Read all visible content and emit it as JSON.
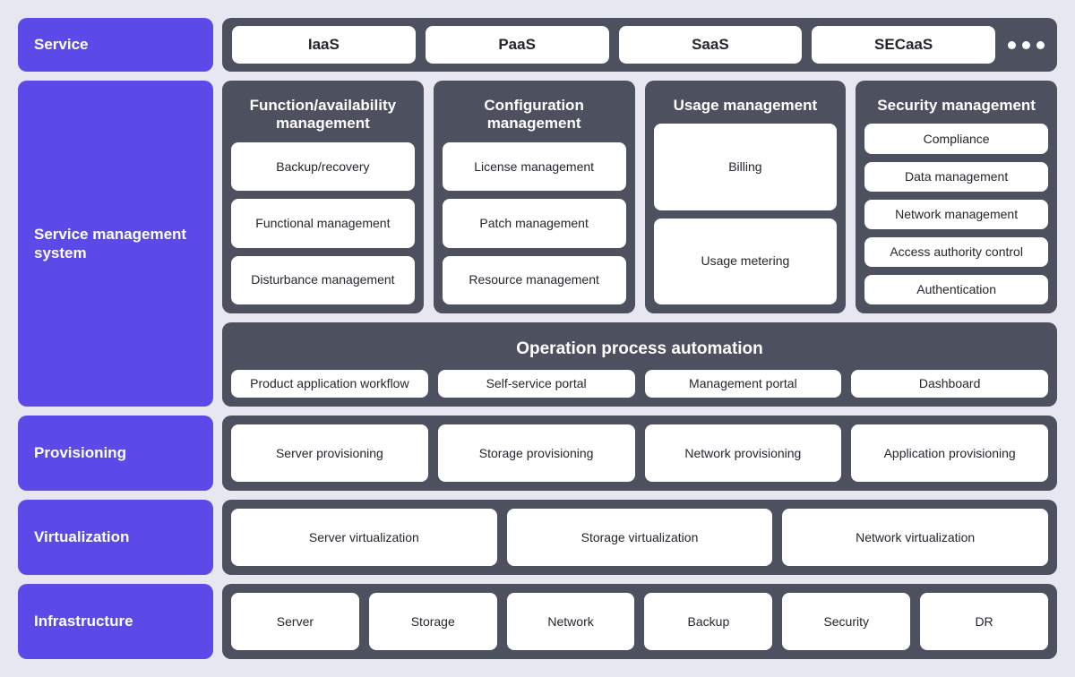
{
  "colors": {
    "background": "#e7e7f1",
    "rail": "#5b4ae8",
    "panel": "#4d505e",
    "chip": "#ffffff",
    "chip_text": "#25252d"
  },
  "rail": {
    "items": [
      {
        "label": "Service"
      },
      {
        "label": "Service management system"
      },
      {
        "label": "Provisioning"
      },
      {
        "label": "Virtualization"
      },
      {
        "label": "Infrastructure"
      }
    ]
  },
  "service_row": {
    "models": [
      "IaaS",
      "PaaS",
      "SaaS",
      "SECaaS"
    ],
    "more_icon": "ellipsis-icon"
  },
  "management": {
    "columns": [
      {
        "title": "Function/availability management",
        "items": [
          "Backup/recovery",
          "Functional management",
          "Disturbance management"
        ]
      },
      {
        "title": "Configuration management",
        "items": [
          "License management",
          "Patch management",
          "Resource management"
        ]
      },
      {
        "title": "Usage management",
        "items": [
          "Billing",
          "Usage metering"
        ]
      },
      {
        "title": "Security management",
        "items": [
          "Compliance",
          "Data management",
          "Network management",
          "Access authority control",
          "Authentication"
        ]
      }
    ]
  },
  "operation_process_automation": {
    "title": "Operation process automation",
    "items": [
      "Product application workflow",
      "Self-service portal",
      "Management portal",
      "Dashboard"
    ]
  },
  "provisioning": {
    "items": [
      "Server provisioning",
      "Storage provisioning",
      "Network provisioning",
      "Application provisioning"
    ]
  },
  "virtualization": {
    "items": [
      "Server virtualization",
      "Storage virtualization",
      "Network virtualization"
    ]
  },
  "infrastructure": {
    "items": [
      "Server",
      "Storage",
      "Network",
      "Backup",
      "Security",
      "DR"
    ]
  }
}
